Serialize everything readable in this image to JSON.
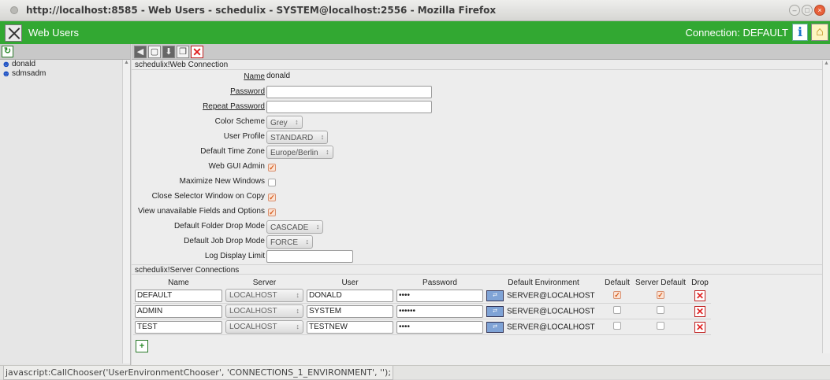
{
  "window": {
    "title": "http://localhost:8585 - Web Users - schedulix - SYSTEM@localhost:2556 - Mozilla Firefox",
    "controls": [
      "–",
      "□",
      "×"
    ]
  },
  "app": {
    "title": "Web Users",
    "connection": "Connection: DEFAULT",
    "info_glyph": "i",
    "home_glyph": "⌂"
  },
  "sidebar": {
    "refresh_glyph": "↻",
    "users": [
      {
        "label": "donald",
        "icon": "user-icon"
      },
      {
        "label": "sdmsadm",
        "icon": "user-icon"
      }
    ]
  },
  "toolbar": {
    "glyphs": {
      "back": "◀",
      "new": "▢",
      "save": "⬇",
      "copy": "❐",
      "drop": "✕"
    }
  },
  "form": {
    "section_title": "schedulix!Web Connection",
    "name_label": "Name",
    "name_value": "donald",
    "password_label": "Password",
    "password_value": "",
    "repeat_password_label": "Repeat Password",
    "repeat_password_value": "",
    "color_scheme_label": "Color Scheme",
    "color_scheme_value": "Grey",
    "user_profile_label": "User Profile",
    "user_profile_value": "STANDARD",
    "time_zone_label": "Default Time Zone",
    "time_zone_value": "Europe/Berlin",
    "web_gui_admin_label": "Web GUI Admin",
    "web_gui_admin_checked": true,
    "maximize_label": "Maximize New Windows",
    "maximize_checked": false,
    "close_selector_label": "Close Selector Window on Copy",
    "close_selector_checked": true,
    "view_unavailable_label": "View unavailable Fields and Options",
    "view_unavailable_checked": true,
    "folder_drop_label": "Default Folder Drop Mode",
    "folder_drop_value": "CASCADE",
    "job_drop_label": "Default Job Drop Mode",
    "job_drop_value": "FORCE",
    "log_limit_label": "Log Display Limit",
    "log_limit_value": ""
  },
  "connections": {
    "section_title": "schedulix!Server Connections",
    "columns": [
      "Name",
      "Server",
      "User",
      "Password",
      "Default Environment",
      "Default",
      "Server Default",
      "Drop"
    ],
    "rows": [
      {
        "name": "DEFAULT",
        "server": "LOCALHOST",
        "user": "DONALD",
        "password": "••••",
        "environment": "SERVER@LOCALHOST",
        "default": true,
        "server_default": true
      },
      {
        "name": "ADMIN",
        "server": "LOCALHOST",
        "user": "SYSTEM",
        "password": "••••••",
        "environment": "SERVER@LOCALHOST",
        "default": false,
        "server_default": false
      },
      {
        "name": "TEST",
        "server": "LOCALHOST",
        "user": "TESTNEW",
        "password": "••••",
        "environment": "SERVER@LOCALHOST",
        "default": false,
        "server_default": false
      }
    ],
    "add_glyph": "+"
  },
  "status": {
    "text": "javascript:CallChooser('UserEnvironmentChooser', 'CONNECTIONS_1_ENVIRONMENT', '');"
  },
  "colors": {
    "app_header": "#32a832",
    "checkbox_on": "#d65a1a",
    "drop": "#e02020"
  }
}
